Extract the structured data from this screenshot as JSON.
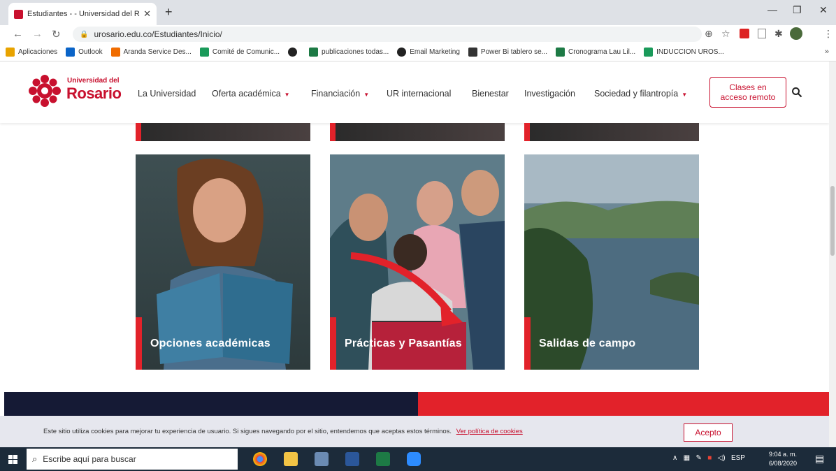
{
  "browser": {
    "tab_title": "Estudiantes - - Universidad del R",
    "url": "urosario.edu.co/Estudiantes/Inicio/",
    "bookmarks": [
      {
        "label": "Aplicaciones",
        "icon": "apps-grid-icon",
        "color": "#e8a300"
      },
      {
        "label": "Outlook",
        "icon": "outlook-icon",
        "color": "#0a64c8"
      },
      {
        "label": "Aranda Service Des...",
        "icon": "aranda-icon",
        "color": "#f06c00"
      },
      {
        "label": "Comité de Comunic...",
        "icon": "sheets-icon",
        "color": "#1a9a5a"
      },
      {
        "label": "",
        "icon": "github-icon",
        "color": "#222222"
      },
      {
        "label": "publicaciones todas...",
        "icon": "excel-icon",
        "color": "#1d7a45"
      },
      {
        "label": "Email Marketing",
        "icon": "github-icon",
        "color": "#222222"
      },
      {
        "label": "Power Bi tablero se...",
        "icon": "powerbi-icon",
        "color": "#333333"
      },
      {
        "label": "Cronograma Lau Lil...",
        "icon": "excel-icon",
        "color": "#1d7a45"
      },
      {
        "label": "INDUCCION UROS...",
        "icon": "sheets-icon",
        "color": "#1a9a5a"
      }
    ],
    "more": "»"
  },
  "site": {
    "logo_small": "Universidad del",
    "logo_big": "Rosario",
    "nav": [
      {
        "label": "La Universidad",
        "dropdown": false
      },
      {
        "label": "Oferta académica",
        "dropdown": true
      },
      {
        "label": "Financiación",
        "dropdown": true
      },
      {
        "label": "UR internacional",
        "dropdown": false
      },
      {
        "label": "Bienestar",
        "dropdown": false
      },
      {
        "label": "Investigación",
        "dropdown": false
      },
      {
        "label": "Sociedad y filantropía",
        "dropdown": true
      }
    ],
    "remote_button": {
      "line1": "Clases en",
      "line2": "acceso remoto"
    },
    "accent_color": "#c8102e"
  },
  "cards": [
    {
      "label": "Opciones académicas"
    },
    {
      "label": "Prácticas y Pasantías"
    },
    {
      "label": "Salidas de campo"
    }
  ],
  "cookie": {
    "text": "Este sitio utiliza cookies para mejorar tu experiencia de usuario. Si sigues navegando por el sitio, entendemos que aceptas estos términos.",
    "link": "Ver política de cookies",
    "accept": "Acepto"
  },
  "taskbar": {
    "search_placeholder": "Escribe aquí para buscar",
    "language": "ESP",
    "time": "9:04 a. m.",
    "date": "6/08/2020"
  }
}
